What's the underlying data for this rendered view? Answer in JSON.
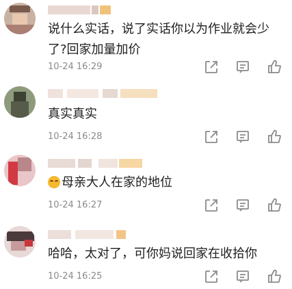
{
  "comments": [
    {
      "text": "说什么实话，说了实话你以为作业就会少了?回家加量加价",
      "time": "10-24 16:29",
      "has_emoji": false
    },
    {
      "text": "真实真实",
      "time": "10-24 16:28",
      "has_emoji": false
    },
    {
      "text": "母亲大人在家的地位",
      "time": "10-24 16:27",
      "has_emoji": true,
      "emoji_icon": "laughing-tears-emoji-icon"
    },
    {
      "text": "哈哈，太对了，可你妈说回家在收拾你",
      "time": "10-24 16:25",
      "has_emoji": false
    }
  ],
  "actions": [
    "share-icon",
    "reply-comment-icon",
    "like-icon"
  ],
  "colors": {
    "icon": "#8a8a8a",
    "time": "#8a8a8a",
    "text": "#1e1e1e"
  }
}
